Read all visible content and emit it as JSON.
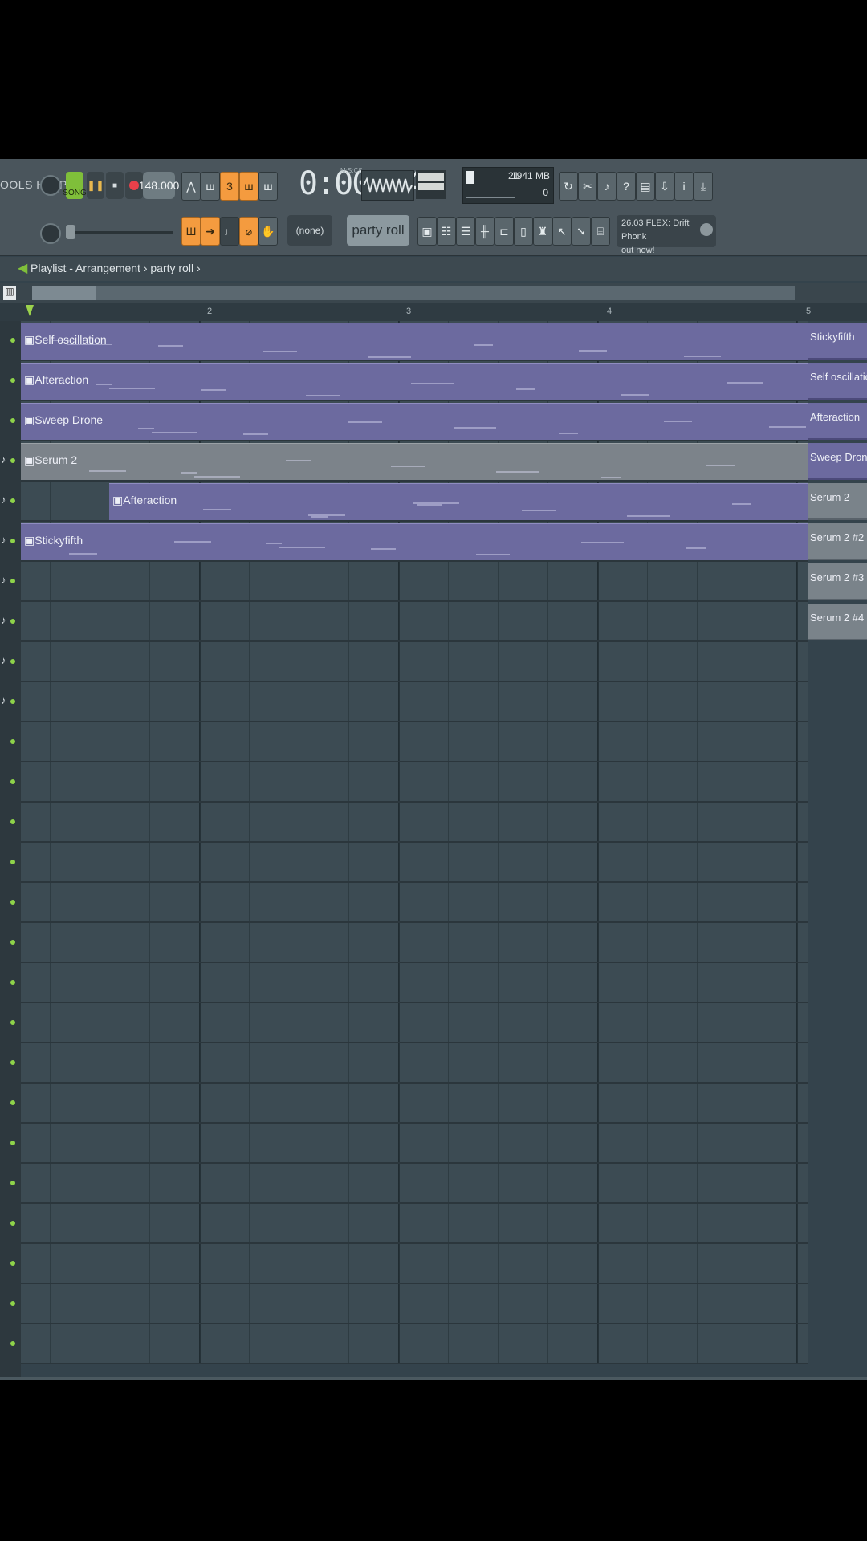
{
  "toolbar": {
    "menu_text": "OOLS HELP",
    "song_label": "SONG",
    "play_glyph": "❚❚",
    "stop_glyph": "■",
    "tempo": "148.000",
    "time": "0:00:14",
    "time_sub": "M:S:CS",
    "cpu_value": "21",
    "memory": "1941 MB",
    "cpu_sub": "0",
    "pattern_selector": "(none)",
    "pattern_name": "party roll",
    "hint_line1": "26.03 FLEX: Drift Phonk",
    "hint_line2": "out now!",
    "icons": [
      "waveform-icon",
      "metronome-icon",
      "blend-icon",
      "step-record-icon",
      "typing-keyboard-icon",
      "undo-icon",
      "cut-icon",
      "microphone-icon",
      "help-icon",
      "save-icon",
      "export-icon",
      "info-icon",
      "download-icon"
    ]
  },
  "breadcrumb": {
    "text": "Playlist - Arrangement › party roll ›"
  },
  "ruler": {
    "marks": [
      "2",
      "3",
      "4",
      "5"
    ]
  },
  "tracks": [
    {
      "clips": [
        {
          "label": "Self oscillation",
          "color": "#6c6a9f"
        }
      ]
    },
    {
      "clips": [
        {
          "label": "Afteraction",
          "color": "#6c6a9f"
        }
      ]
    },
    {
      "clips": [
        {
          "label": "Sweep Drone",
          "color": "#6c6a9f"
        }
      ]
    },
    {
      "clips": [
        {
          "label": "Serum 2",
          "color": "#7c838a"
        }
      ]
    },
    {
      "clips": [
        {
          "label": "Afteraction",
          "color": "#6c6a9f"
        }
      ]
    },
    {
      "clips": [
        {
          "label": "Stickyfifth",
          "color": "#6c6a9f"
        }
      ]
    }
  ],
  "picker": [
    {
      "label": "Stickyfifth"
    },
    {
      "label": "Self oscillation"
    },
    {
      "label": "Afteraction"
    },
    {
      "label": "Sweep Drone"
    },
    {
      "label": "Serum 2"
    },
    {
      "label": "Serum 2 #2"
    },
    {
      "label": "Serum 2 #3"
    },
    {
      "label": "Serum 2 #4"
    }
  ]
}
